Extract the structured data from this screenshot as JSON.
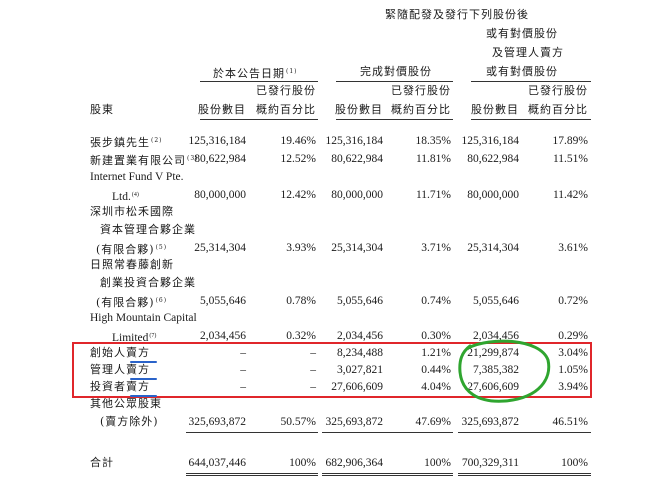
{
  "header": {
    "group1": "於本公告日期",
    "group1_note": "(1)",
    "group2": "完成對價股份",
    "group3": [
      "緊隨配發及發行下列股份後",
      "或有對價股份",
      "及管理人賣方",
      "或有對價股份"
    ],
    "shareholder": "股東",
    "shares_label": "股份數目",
    "pct_label_1": "已發行股份",
    "pct_label_2": "概約百分比"
  },
  "rows": [
    {
      "name_lines": [
        "張步鎮先生"
      ],
      "note": "(2)",
      "c1": "125,316,184",
      "p1": "19.46%",
      "c2": "125,316,184",
      "p2": "18.35%",
      "c3": "125,316,184",
      "p3": "17.89%"
    },
    {
      "name_lines": [
        "新建置業有限公司"
      ],
      "note": "(3)",
      "c1": "80,622,984",
      "p1": "12.52%",
      "c2": "80,622,984",
      "p2": "11.81%",
      "c3": "80,622,984",
      "p3": "11.51%"
    },
    {
      "name_lines": [
        "Internet Fund V Pte.",
        "Ltd."
      ],
      "note": "(4)",
      "c1": "80,000,000",
      "p1": "12.42%",
      "c2": "80,000,000",
      "p2": "11.71%",
      "c3": "80,000,000",
      "p3": "11.42%"
    },
    {
      "name_lines": [
        "深圳市松禾國際",
        "資本管理合夥企業",
        "(有限合夥)"
      ],
      "note": "(5)",
      "c1": "25,314,304",
      "p1": "3.93%",
      "c2": "25,314,304",
      "p2": "3.71%",
      "c3": "25,314,304",
      "p3": "3.61%"
    },
    {
      "name_lines": [
        "日照常春藤創新",
        "創業投資合夥企業",
        "(有限合夥)"
      ],
      "note": "(6)",
      "c1": "5,055,646",
      "p1": "0.78%",
      "c2": "5,055,646",
      "p2": "0.74%",
      "c3": "5,055,646",
      "p3": "0.72%"
    },
    {
      "name_lines": [
        "High Mountain Capital",
        "Limited"
      ],
      "note": "(7)",
      "c1": "2,034,456",
      "p1": "0.32%",
      "c2": "2,034,456",
      "p2": "0.30%",
      "c3": "2,034,456",
      "p3": "0.29%"
    },
    {
      "name_lines": [
        "創始人賣方"
      ],
      "note": "",
      "c1": "–",
      "p1": "–",
      "c2": "8,234,488",
      "p2": "1.21%",
      "c3": "21,299,874",
      "p3": "3.04%"
    },
    {
      "name_lines": [
        "管理人賣方"
      ],
      "note": "",
      "c1": "–",
      "p1": "–",
      "c2": "3,027,821",
      "p2": "0.44%",
      "c3": "7,385,382",
      "p3": "1.05%"
    },
    {
      "name_lines": [
        "投資者賣方"
      ],
      "note": "",
      "c1": "–",
      "p1": "–",
      "c2": "27,606,609",
      "p2": "4.04%",
      "c3": "27,606,609",
      "p3": "3.94%"
    },
    {
      "name_lines": [
        "其他公眾股東",
        "(賣方除外)"
      ],
      "note": "",
      "c1": "325,693,872",
      "p1": "50.57%",
      "c2": "325,693,872",
      "p2": "47.69%",
      "c3": "325,693,872",
      "p3": "46.51%"
    }
  ],
  "total": {
    "label": "合計",
    "c1": "644,037,446",
    "p1": "100%",
    "c2": "682,906,364",
    "p2": "100%",
    "c3": "700,329,311",
    "p3": "100%"
  },
  "annotations": {
    "box_color": "#e0262b",
    "underline_color": "#2a63c9",
    "circle_color": "#2fa52f"
  }
}
